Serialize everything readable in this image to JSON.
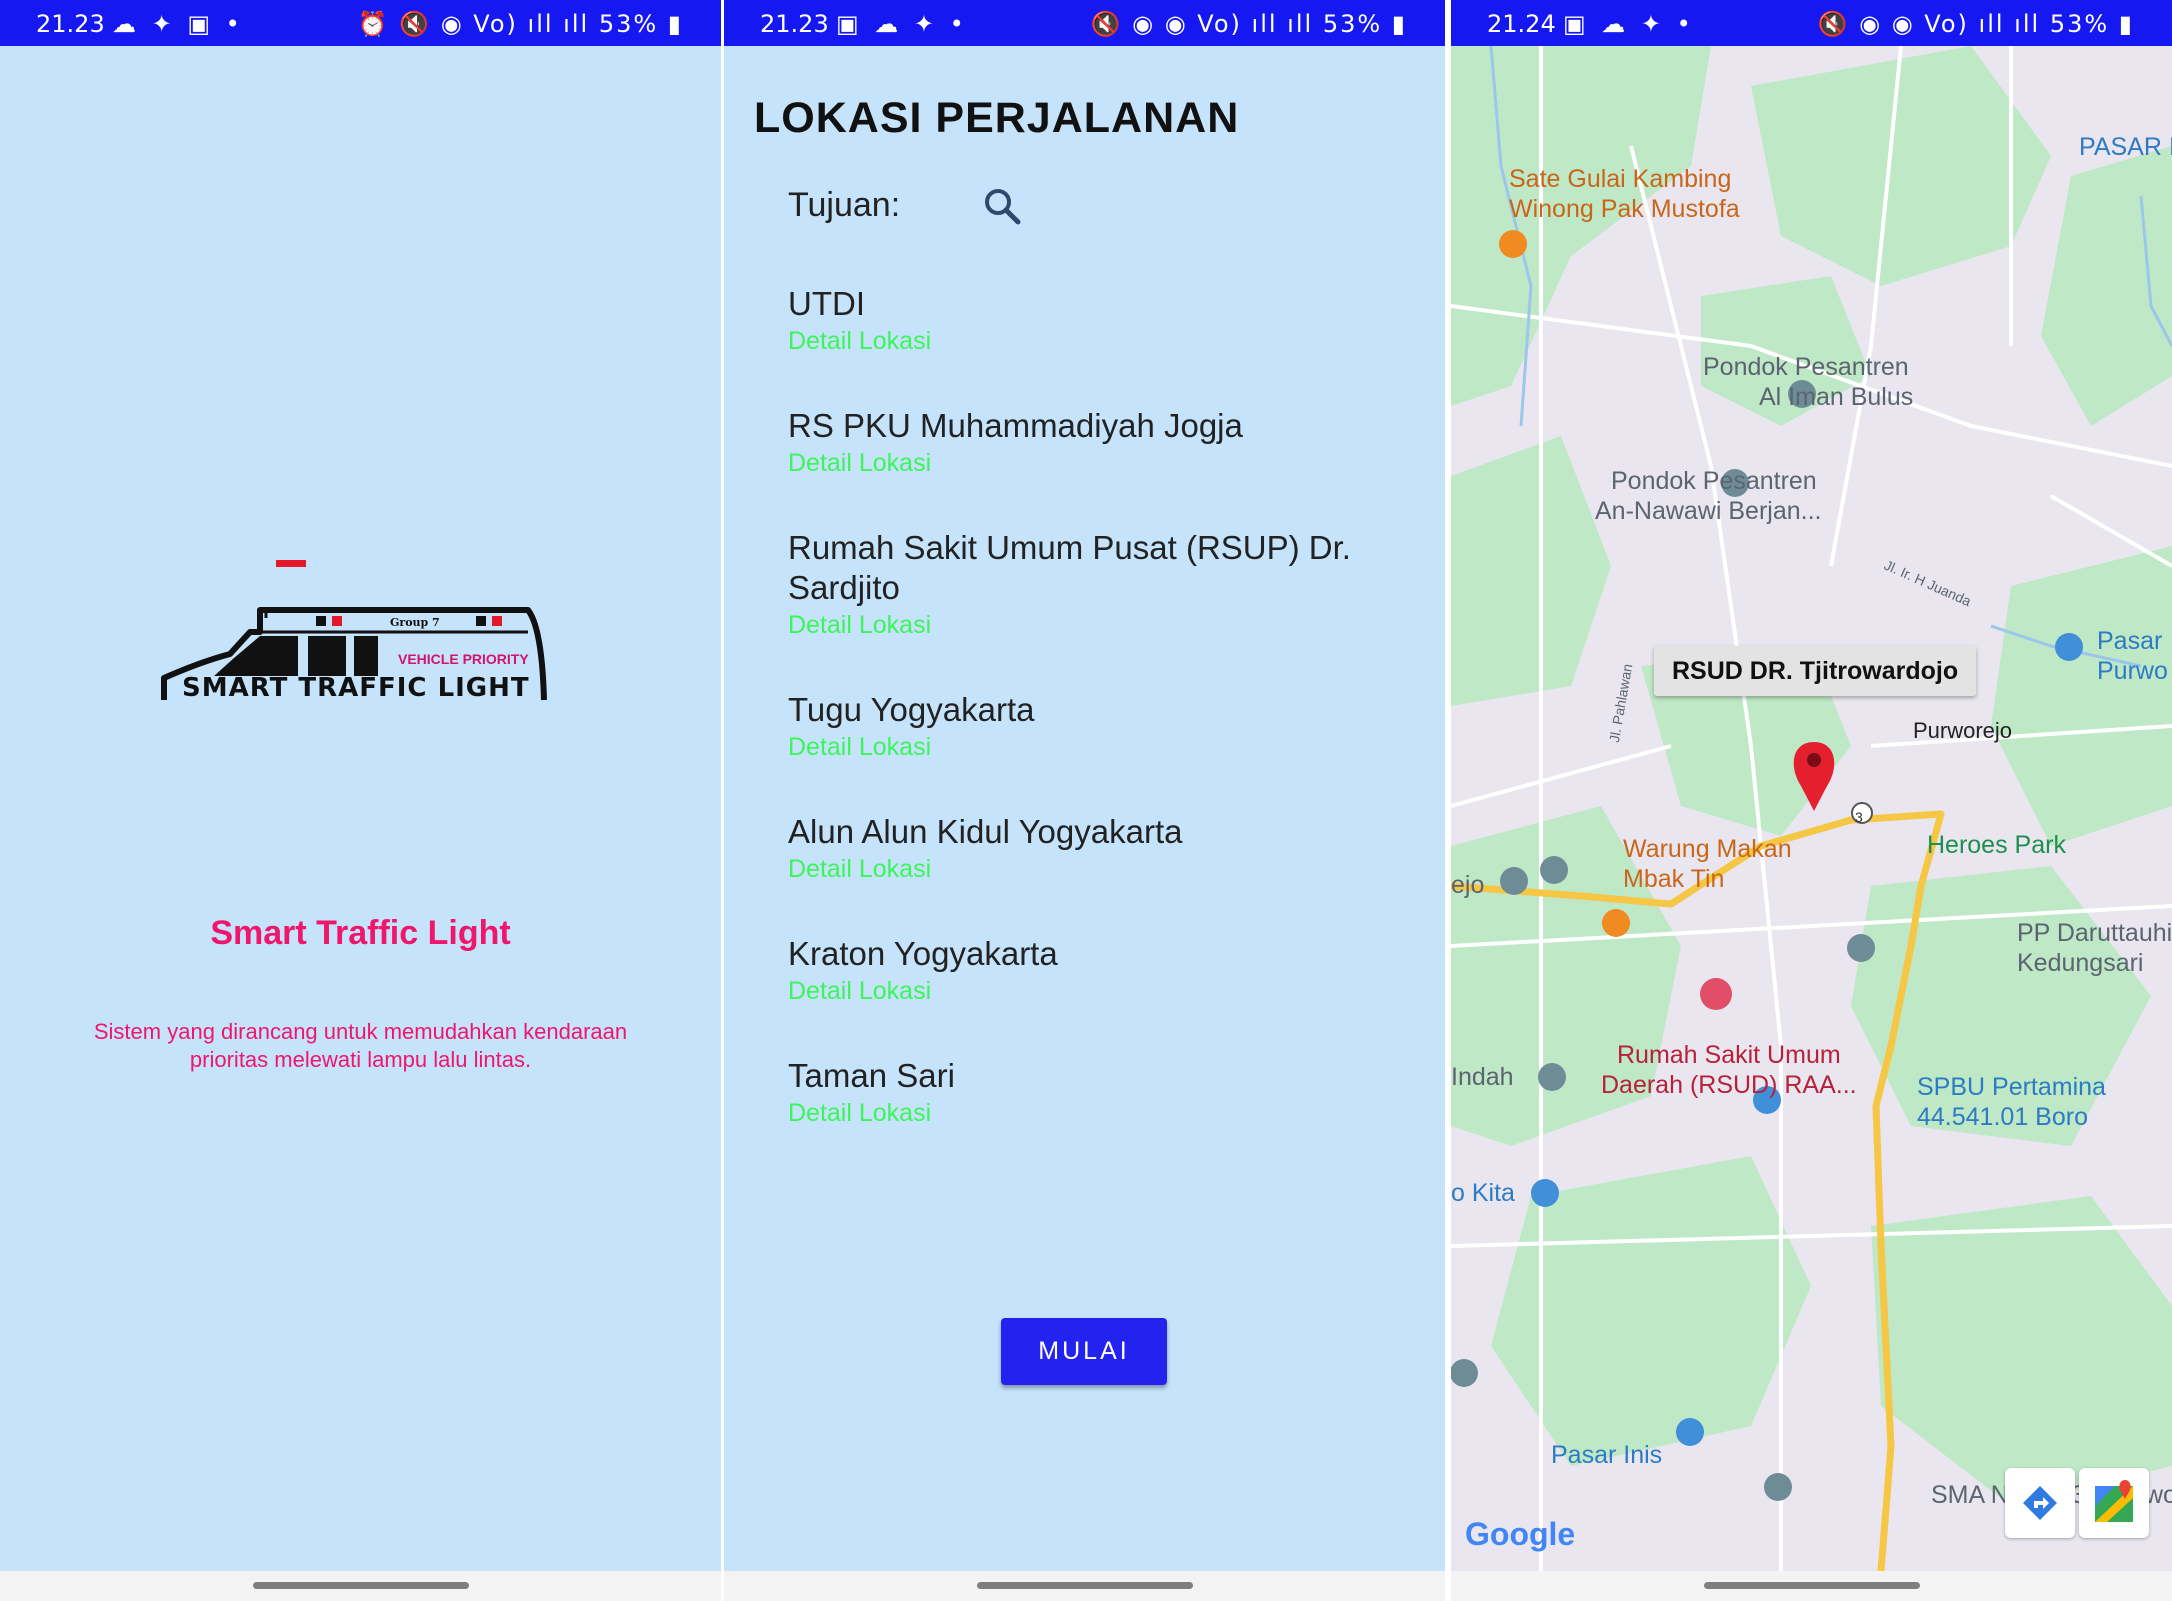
{
  "screen1": {
    "status": {
      "time": "21.23",
      "left_icons": "☁ ✦ ▣ •",
      "right_icons": "⏰ 🔇 ◉ Vo) ıll ıll",
      "battery": "53%"
    },
    "logo": {
      "group": "Group 7",
      "tag": "VEHICLE PRIORITY",
      "wordmark": "SMART TRAFFIC LIGHT"
    },
    "title": "Smart Traffic Light",
    "description": "Sistem yang dirancang untuk memudahkan kendaraan prioritas melewati lampu lalu lintas."
  },
  "screen2": {
    "status": {
      "time": "21.23",
      "left_icons": "▣ ☁ ✦ •",
      "right_icons": "🔇 ◉ ◉ Vo) ıll ıll",
      "battery": "53%"
    },
    "title": "LOKASI PERJALANAN",
    "destination_label": "Tujuan:",
    "locations": [
      {
        "name": "UTDI",
        "detail": "Detail Lokasi"
      },
      {
        "name": "RS PKU Muhammadiyah Jogja",
        "detail": "Detail Lokasi"
      },
      {
        "name": "Rumah Sakit Umum Pusat (RSUP) Dr. Sardjito",
        "detail": "Detail Lokasi"
      },
      {
        "name": "Tugu Yogyakarta",
        "detail": "Detail Lokasi"
      },
      {
        "name": "Alun Alun Kidul Yogyakarta",
        "detail": "Detail Lokasi"
      },
      {
        "name": "Kraton Yogyakarta",
        "detail": "Detail Lokasi"
      },
      {
        "name": "Taman Sari",
        "detail": "Detail Lokasi"
      }
    ],
    "start_button": "MULAI"
  },
  "screen3": {
    "status": {
      "time": "21.24",
      "left_icons": "▣ ☁ ✦ •",
      "right_icons": "🔇 ◉ ◉ Vo) ıll ıll",
      "battery": "53%"
    },
    "callout": "RSUD DR. Tjitrowardojo",
    "labels": {
      "pasar_top": "PASAR I",
      "sate": "Sate Gulai Kambing",
      "sate2": "Winong Pak Mustofa",
      "pondok1": "Pondok Pesantren",
      "pondok1b": "Al Iman Bulus",
      "pondok2": "Pondok Pesantren",
      "pondok2b": "An-Nawawi Berjan...",
      "juanda": "Jl. Ir. H Juanda",
      "pahlawan": "Jl. Pahlawan",
      "pasar_right": "Pasar",
      "pasar_right2": "Purwo",
      "purworejo": "Purworejo",
      "heroes": "Heroes Park",
      "warung": "Warung Makan",
      "warung2": "Mbak Tin",
      "ejo": "ejo",
      "pp": "PP Daruttauhi",
      "pp2": "Kedungsari",
      "rs": "Rumah Sakit Umum",
      "rs2": "Daerah (RSUD) RAA...",
      "indah": "Indah",
      "spbu": "SPBU Pertamina",
      "spbu2": "44.541.01 Boro",
      "kita": "o Kita",
      "pasar_inis": "Pasar Inis",
      "sma": "SMA Negeri 3",
      "wo": "wo",
      "route_num": "3"
    },
    "google": "Google"
  },
  "colors": {
    "status_bar": "#1518f0",
    "background": "#c5e3fb",
    "accent_pink": "#f0166b",
    "detail_green": "#3df45a",
    "button_blue": "#2323ef",
    "pin_red": "#e5202e"
  }
}
